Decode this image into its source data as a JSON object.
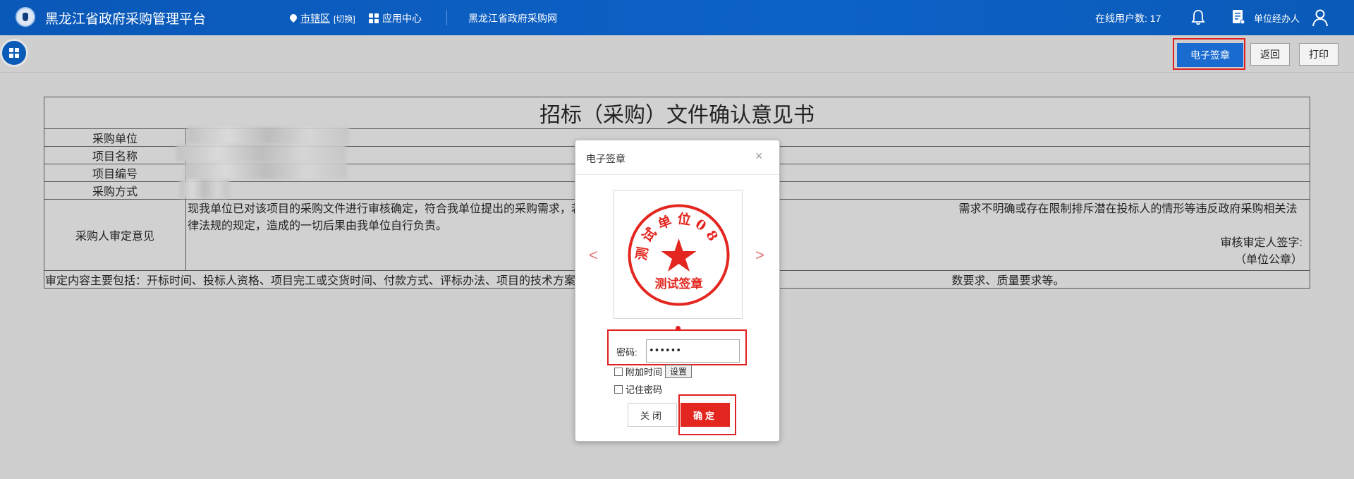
{
  "header": {
    "app_title": "黑龙江省政府采购管理平台",
    "region_label": "市辖区",
    "region_switch": "[切换]",
    "app_center_label": "应用中心",
    "portal_link": "黑龙江省政府采购网",
    "online_users": "在线用户数: 17",
    "user_name": "单位经办人"
  },
  "toolbar": {
    "esign_label": "电子签章",
    "back_label": "返回",
    "print_label": "打印"
  },
  "form": {
    "title": "招标（采购）文件确认意见书",
    "rows": [
      {
        "label": "采购单位"
      },
      {
        "label": "项目名称"
      },
      {
        "label": "项目编号"
      },
      {
        "label": "采购方式"
      }
    ],
    "opinion_label": "采购人审定意见",
    "opinion_text": "现我单位已对该项目的采购文件进行审核确定，符合我单位提出的采购需求，若                                                                                                                        需求不明确或存在限制排斥潜在投标人的情形等违反政府采购相关法律法规的规定，造成的一切后果由我单位自行负责。",
    "signature_line": "审核审定人签字:",
    "seal_line": "（单位公章）",
    "note": "审定内容主要包括：开标时间、投标人资格、项目完工或交货时间、付款方式、评标办法、项目的技术方案                                                                                                                        数要求、质量要求等。"
  },
  "modal": {
    "title": "电子签章",
    "close_symbol": "×",
    "prev_symbol": "<",
    "next_symbol": ">",
    "stamp": {
      "top_text": "测试单位08",
      "bottom_text": "测试签章",
      "color": "#e3261f"
    },
    "password_label": "密码:",
    "password_value": "••••••",
    "add_time_label": "附加时间",
    "settings_label": "设置",
    "remember_label": "记住密码",
    "close_label": "关闭",
    "confirm_label": "确定"
  },
  "colors": {
    "header_bg": "#0d62c6",
    "primary_button": "#1a6bd0",
    "confirm_button": "#e3261f",
    "highlight": "#e02020",
    "page_bg": "#cfcfcf"
  }
}
